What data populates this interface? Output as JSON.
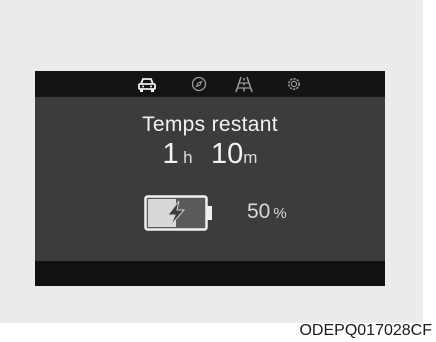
{
  "tabs": [
    {
      "icon": "car-icon",
      "active": true
    },
    {
      "icon": "compass-icon",
      "active": false
    },
    {
      "icon": "road-icon",
      "active": false
    },
    {
      "icon": "gear-icon",
      "active": false
    }
  ],
  "main": {
    "title": "Temps restant",
    "hours_value": "1",
    "hours_unit": "h",
    "minutes_value": "10",
    "minutes_unit": "m"
  },
  "battery": {
    "icon": "battery-charging-icon",
    "level": 0.5,
    "value": "50",
    "unit": "%"
  },
  "figure_code": "ODEPQ017028CF",
  "colors": {
    "screen_bg": "#3c3c3c",
    "bar_bg": "#141414",
    "text": "#f2f2f2"
  }
}
